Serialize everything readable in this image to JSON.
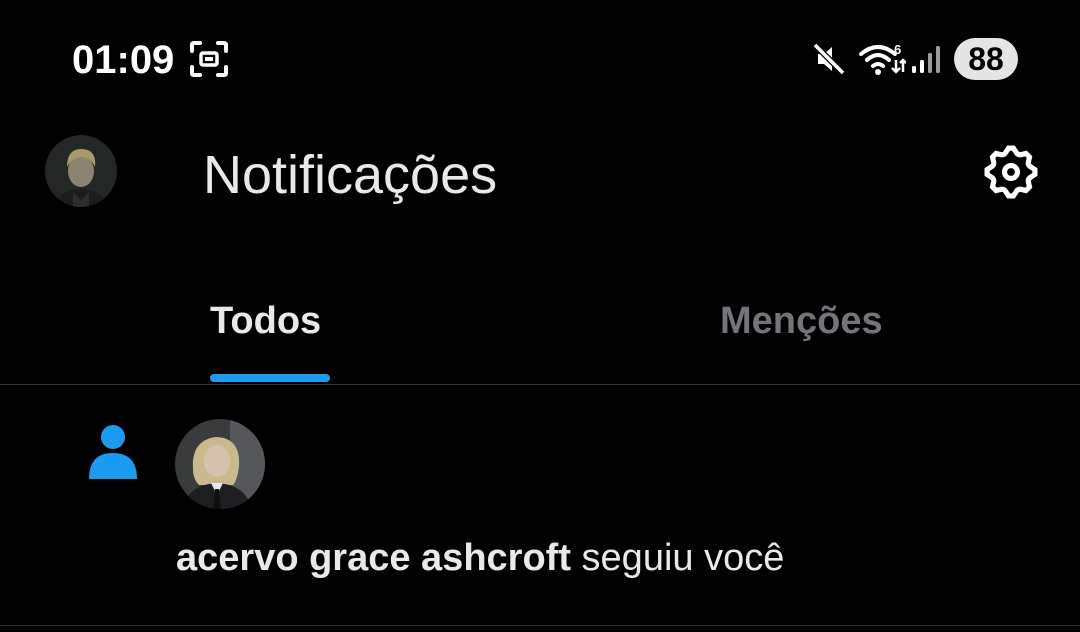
{
  "status_bar": {
    "time": "01:09",
    "battery": "88",
    "icons": [
      "screenshot-icon",
      "mute-icon",
      "wifi-icon",
      "signal-icon"
    ]
  },
  "header": {
    "title": "Notificações",
    "avatar": "avatar",
    "settings_icon": "gear-icon"
  },
  "tabs": [
    {
      "label": "Todos",
      "active": true
    },
    {
      "label": "Menções",
      "active": false
    }
  ],
  "notifications": [
    {
      "type": "follow",
      "icon": "person-icon",
      "user": "acervo grace ashcroft",
      "action": "seguiu você"
    }
  ],
  "colors": {
    "background": "#000000",
    "accent": "#1d9bf0",
    "text_primary": "#e7e9ea",
    "text_secondary": "#71767b",
    "divider": "#2f3336"
  }
}
